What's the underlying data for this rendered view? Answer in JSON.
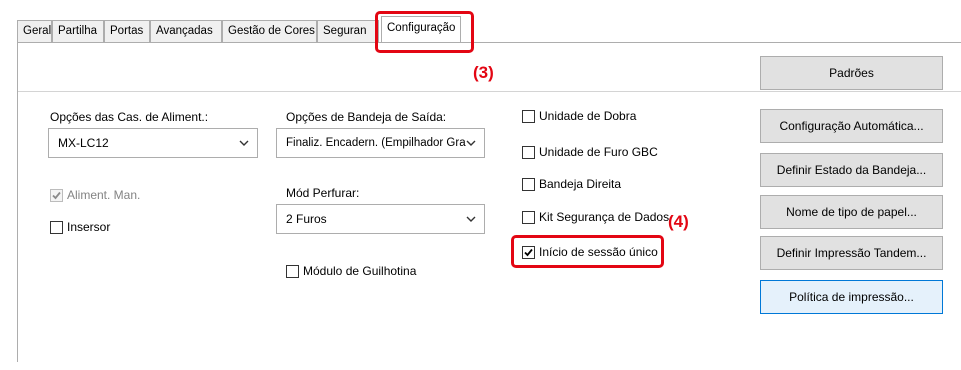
{
  "tabs": [
    "Geral",
    "Partilha",
    "Portas",
    "Avançadas",
    "Gestão de Cores",
    "Seguran",
    "Configuração"
  ],
  "annotations": {
    "step3": "(3)",
    "step4": "(4)"
  },
  "left_column": {
    "feed_label": "Opções das Cas. de Aliment.:",
    "feed_value": "MX-LC12",
    "manual_feed": {
      "label": "Aliment. Man.",
      "checked": true,
      "enabled": false
    },
    "inserter": {
      "label": "Insersor",
      "checked": false
    }
  },
  "middle_column": {
    "output_label": "Opções de Bandeja de Saída:",
    "output_value": "Finaliz. Encadern. (Empilhador Gra",
    "punch_label": "Mód Perfurar:",
    "punch_value": "2 Furos",
    "trimmer": {
      "label": "Módulo de Guilhotina",
      "checked": false
    }
  },
  "right_checks": [
    {
      "label": "Unidade de Dobra",
      "checked": false
    },
    {
      "label": "Unidade de Furo GBC",
      "checked": false
    },
    {
      "label": "Bandeja Direita",
      "checked": false
    },
    {
      "label": "Kit Segurança de Dados",
      "checked": false
    },
    {
      "label": "Início de sessão único",
      "checked": true
    }
  ],
  "buttons": {
    "defaults": "Padrões",
    "auto_config": "Configuração Automática...",
    "tray_status": "Definir Estado da Bandeja...",
    "paper_type": "Nome de tipo de papel...",
    "tandem": "Definir Impressão Tandem...",
    "print_policy": "Política de impressão..."
  },
  "colors": {
    "annotation_red": "#e30613",
    "focus_blue": "#0078d7"
  }
}
